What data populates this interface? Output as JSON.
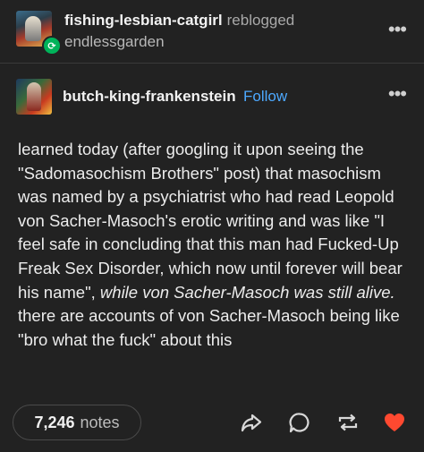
{
  "reblog_header": {
    "reblogger": "fishing-lesbian-catgirl",
    "action": "reblogged",
    "source": "endlessgarden"
  },
  "post": {
    "author": "butch-king-frankenstein",
    "follow_label": "Follow",
    "text_part1": "learned today (after googling it upon seeing the \"Sadomasochism Brothers\" post) that masochism was named by a psychiatrist who had read Leopold von Sacher-Masoch's erotic writing and was like \"I feel safe in concluding that this man had Fucked-Up Freak Sex Disorder, which now until forever will bear his name\",",
    "text_italic": "while von Sacher-Masoch was still alive.",
    "text_part2": "there are accounts of von Sacher-Masoch being like \"bro what the fuck\" about this"
  },
  "footer": {
    "notes_count": "7,246",
    "notes_label": "notes"
  },
  "icons": [
    "more-options-icon",
    "reblog-badge-icon",
    "share-icon",
    "reply-icon",
    "reblog-icon",
    "like-icon"
  ],
  "colors": {
    "background": "#222222",
    "follow": "#4da9ff",
    "reblog_green": "#00b35a",
    "like_red": "#ff4930"
  }
}
